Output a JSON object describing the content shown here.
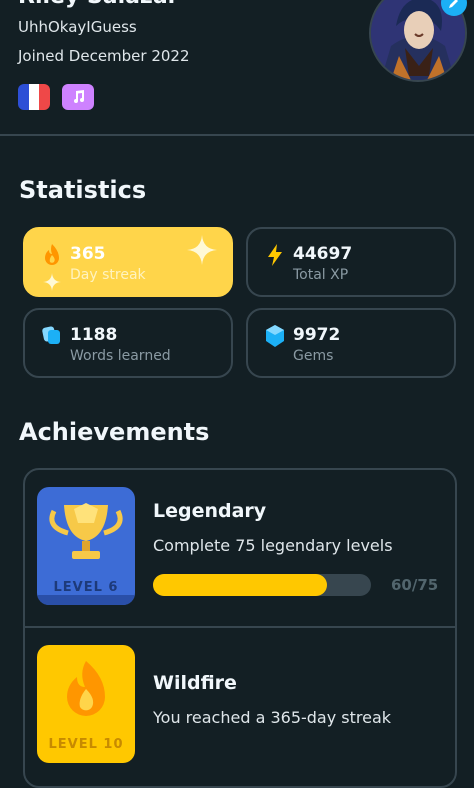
{
  "profile": {
    "name": "Riley Salazar",
    "username": "UhhOkayIGuess",
    "joined": "Joined December 2022",
    "course_flag": "flag-france-icon",
    "music_course": "music-note-icon"
  },
  "statistics": {
    "title": "Statistics",
    "items": [
      {
        "value": "365",
        "label": "Day streak",
        "icon": "fire-icon",
        "color": "#ffd54a"
      },
      {
        "value": "44697",
        "label": "Total XP",
        "icon": "lightning-icon",
        "color": "#ffc800"
      },
      {
        "value": "1188",
        "label": "Words learned",
        "icon": "cards-icon",
        "color": "#49c0f8"
      },
      {
        "value": "9972",
        "label": "Gems",
        "icon": "gem-icon",
        "color": "#1cb0f6"
      }
    ]
  },
  "achievements": {
    "title": "Achievements",
    "items": [
      {
        "title": "Legendary",
        "description": "Complete 75 legendary levels",
        "level": "LEVEL 6",
        "progress": 0.8,
        "progress_text": "60/75",
        "badge_color": "#3d6cd6"
      },
      {
        "title": "Wildfire",
        "description": "You reached a 365-day streak",
        "level": "LEVEL 10",
        "badge_color": "#ffc800"
      }
    ]
  }
}
